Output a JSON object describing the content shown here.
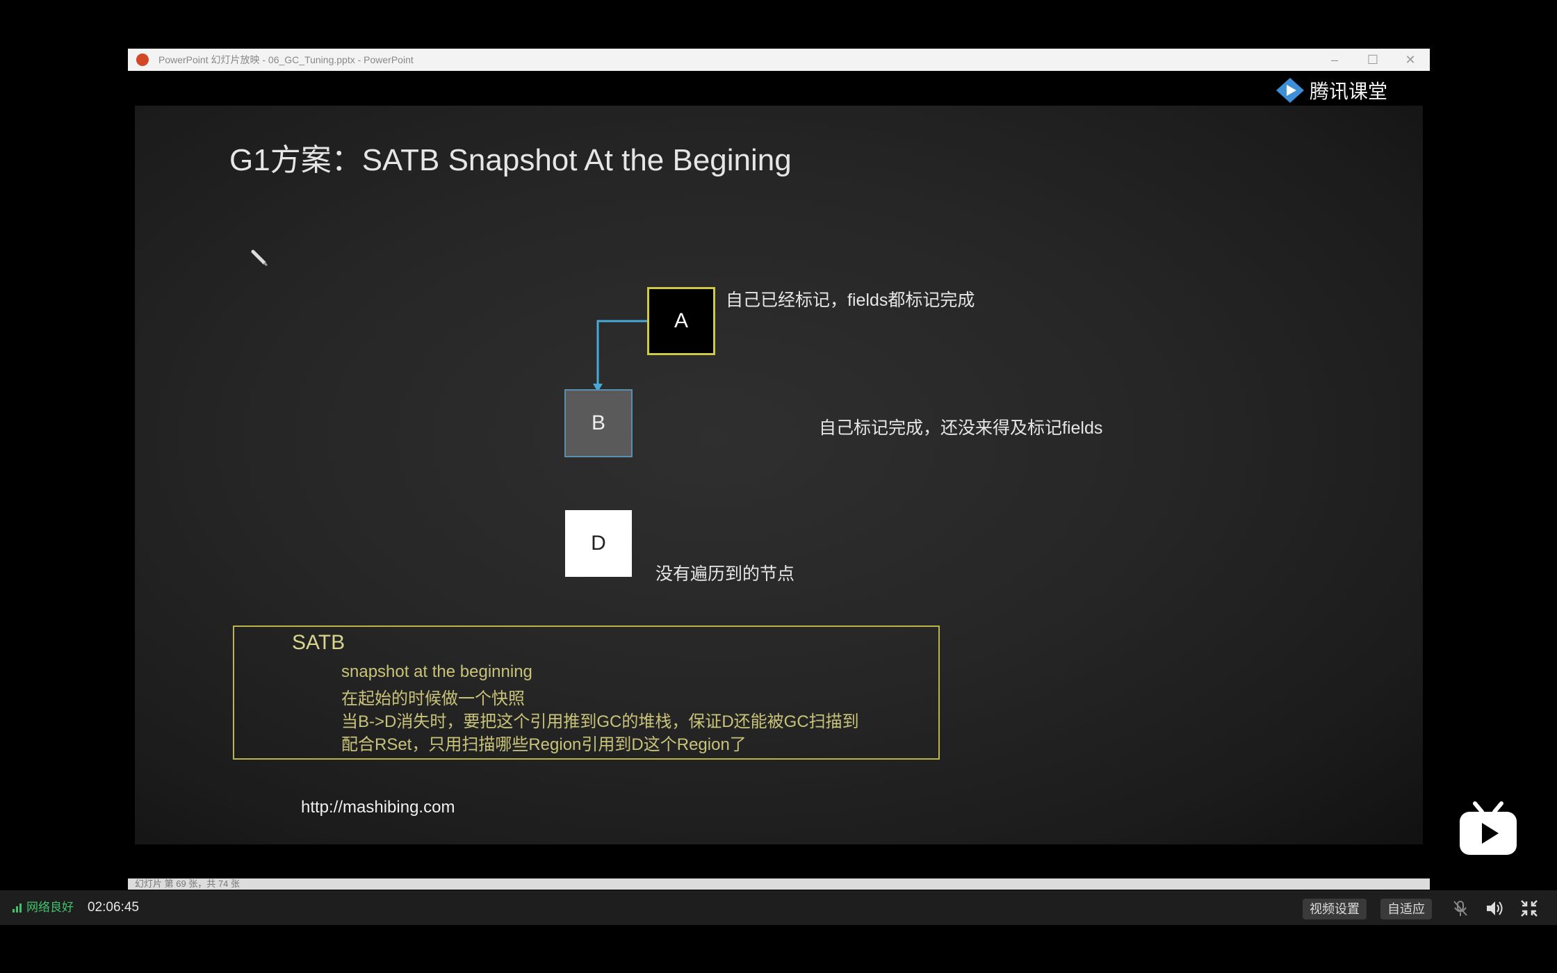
{
  "window": {
    "title": "PowerPoint 幻灯片放映 - 06_GC_Tuning.pptx - PowerPoint",
    "controls": {
      "minimize": "–",
      "maximize": "☐",
      "close": "✕"
    }
  },
  "slide": {
    "title": "G1方案：SATB Snapshot At the Begining",
    "nodes": {
      "a": "A",
      "b": "B",
      "d": "D"
    },
    "annotations": {
      "a": "自己已经标记，fields都标记完成",
      "b": "自己标记完成，还没来得及标记fields",
      "d": "没有遍历到的节点"
    },
    "satb": {
      "title": "SATB",
      "lines": [
        "snapshot at the beginning",
        "在起始的时候做一个快照",
        "当B->D消失时，要把这个引用推到GC的堆栈，保证D还能被GC扫描到",
        "配合RSet，只用扫描哪些Region引用到D这个Region了"
      ]
    },
    "url": "http://mashibing.com",
    "watermark": "腾讯课堂"
  },
  "ppt_status": {
    "text": "幻灯片 第 69 张，共 74 张"
  },
  "player": {
    "network_status": "网络良好",
    "time": "02:06:45",
    "video_settings_label": "视频设置",
    "adaptive_label": "自适应"
  },
  "colors": {
    "slide_bg": "#262626",
    "accent_yellow": "#bdb54c",
    "edge_blue": "#4aa8d8",
    "network_green": "#3ec46d"
  }
}
